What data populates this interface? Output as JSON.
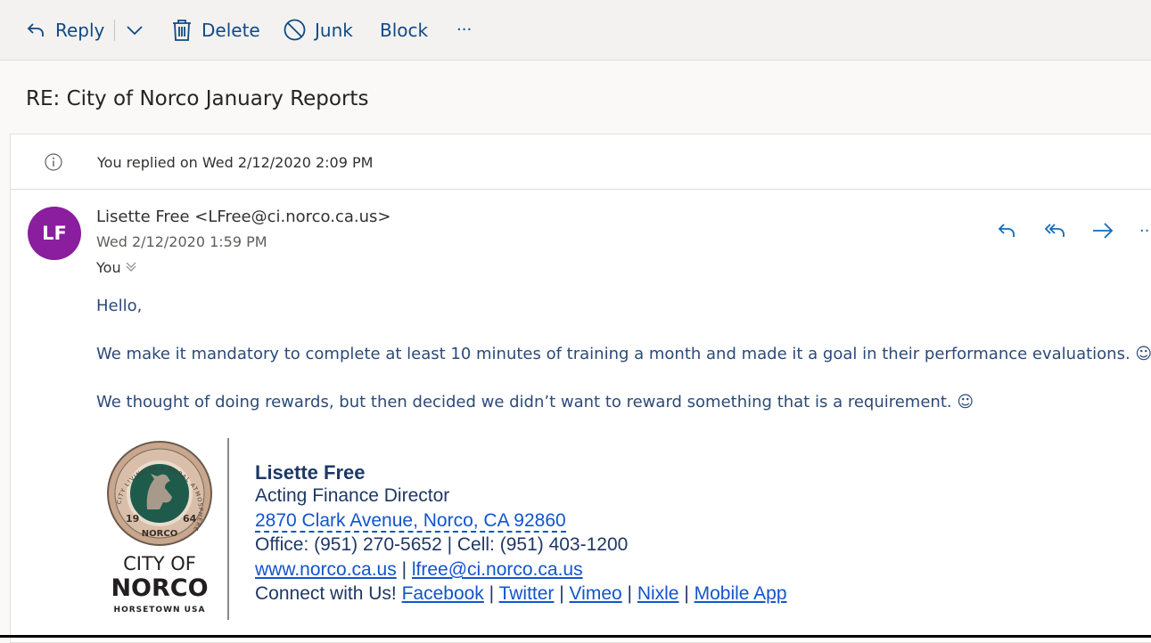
{
  "toolbar": {
    "reply": "Reply",
    "delete": "Delete",
    "junk": "Junk",
    "block": "Block",
    "more": "···"
  },
  "subject": "RE: City of Norco January Reports",
  "info": {
    "text": "You replied on Wed 2/12/2020 2:09 PM"
  },
  "message": {
    "avatar_initials": "LF",
    "avatar_color": "#8a1e9e",
    "sender": "Lisette Free <LFree@ci.norco.ca.us>",
    "date": "Wed 2/12/2020 1:59 PM",
    "to": "You",
    "more": "···",
    "greeting": "Hello,",
    "para1": "We make it mandatory to complete at least 10 minutes of training a month and made it a goal in their performance evaluations. ☺",
    "para2": "We thought of doing rewards, but then decided we didn’t want to reward something that is a requirement. ☺"
  },
  "logo": {
    "ring_text": "CITY LIVING IN A RURAL ATMOSPHERE",
    "city_of": "CITY OF",
    "norco": "NORCO",
    "tagline": "HORSETOWN USA",
    "seal_left": "19",
    "seal_right": "64",
    "seal_bottom": "NORCO"
  },
  "signature": {
    "name": "Lisette Free",
    "title": "Acting Finance Director",
    "address": "2870 Clark Avenue, Norco, CA 92860",
    "phones": "Office: (951) 270-5652 | Cell: (951) 403-1200",
    "website": "www.norco.ca.us",
    "sep1": " | ",
    "email": "lfree@ci.norco.ca.us",
    "connect": "Connect with Us! ",
    "facebook": "Facebook",
    "twitter": "Twitter",
    "vimeo": "Vimeo",
    "nixle": "Nixle",
    "mobile_app": "Mobile App",
    "pipe": " | "
  }
}
